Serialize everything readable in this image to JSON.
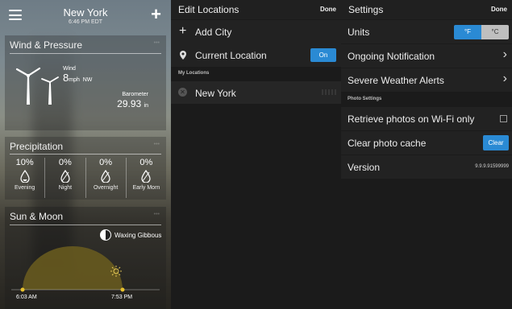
{
  "weather": {
    "city": "New York",
    "time": "6:46 PM EDT",
    "wind_card": {
      "title": "Wind & Pressure",
      "wind_label": "Wind",
      "wind_speed": "8",
      "wind_unit": "mph",
      "wind_dir": "NW",
      "barometer_label": "Barometer",
      "barometer_value": "29.93",
      "barometer_unit": "in"
    },
    "precip_card": {
      "title": "Precipitation",
      "columns": [
        {
          "pct": "10%",
          "label": "Evening"
        },
        {
          "pct": "0%",
          "label": "Night"
        },
        {
          "pct": "0%",
          "label": "Overnight"
        },
        {
          "pct": "0%",
          "label": "Early Morn"
        }
      ]
    },
    "sun_card": {
      "title": "Sun & Moon",
      "moon_phase": "Waxing Gibbous",
      "sunrise": "6:03 AM",
      "sunset": "7:53 PM"
    }
  },
  "edit_locations": {
    "title": "Edit Locations",
    "done": "Done",
    "add_city": "Add City",
    "current_location": "Current Location",
    "current_location_toggle": "On",
    "section_label": "My Locations",
    "locations": [
      "New York"
    ]
  },
  "settings": {
    "title": "Settings",
    "done": "Done",
    "units_label": "Units",
    "unit_f": "°F",
    "unit_c": "°C",
    "ongoing_notification": "Ongoing Notification",
    "severe_alerts": "Severe Weather Alerts",
    "photo_section": "Photo Settings",
    "wifi_photos": "Retrieve photos on Wi-Fi only",
    "clear_cache": "Clear photo cache",
    "clear_button": "Clear",
    "version_label": "Version",
    "version_value": "9.9.9.91599999"
  },
  "colors": {
    "accent": "#2a8ad4",
    "panel_bg": "#1b1b1b",
    "row_bg": "#222222",
    "sun_arc": "#6b5d1e"
  }
}
